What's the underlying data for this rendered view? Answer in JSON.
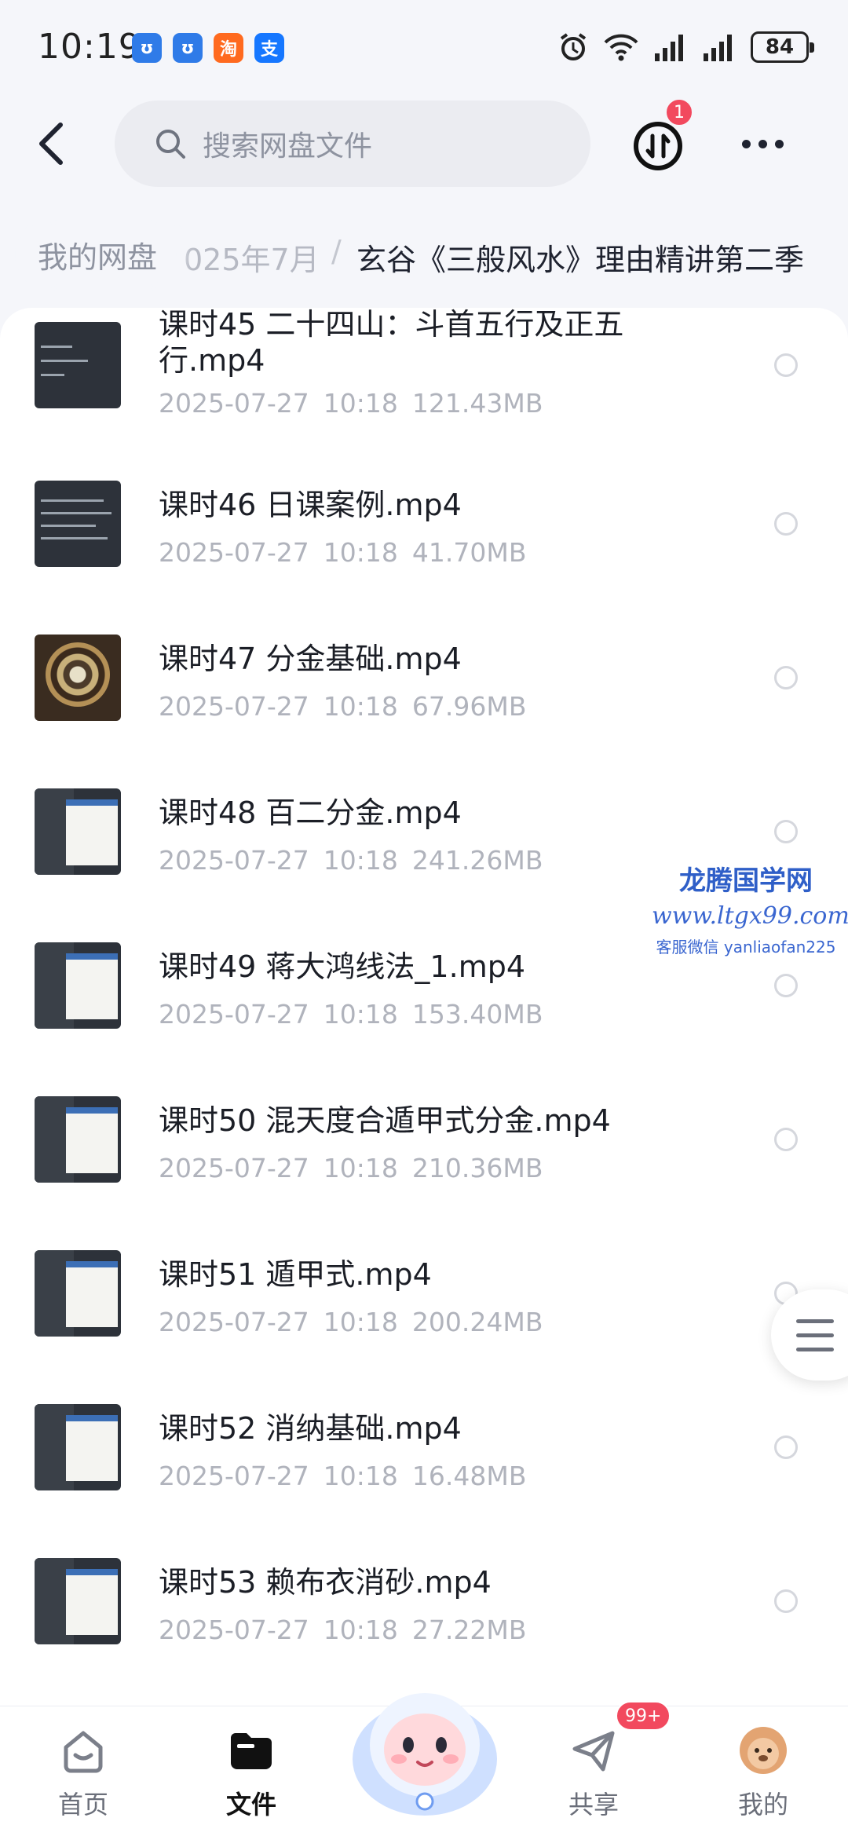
{
  "status_bar": {
    "time": "10:19",
    "notification_icons": [
      {
        "icon": "app-blue-icon",
        "glyph": "ʊ",
        "color": "#2f7be8"
      },
      {
        "icon": "app-blue-icon",
        "glyph": "ʊ",
        "color": "#2f7be8"
      },
      {
        "icon": "taobao-icon",
        "glyph": "淘",
        "color": "#ff6a1f"
      },
      {
        "icon": "alipay-icon",
        "glyph": "支",
        "color": "#1677ff"
      }
    ],
    "battery": "84"
  },
  "header": {
    "search_placeholder": "搜索网盘文件",
    "transfer_badge": "1"
  },
  "breadcrumb": {
    "root": "我的网盘",
    "middle": "025年7月",
    "separator": "/",
    "current": "玄谷《三般风水》理由精讲第二季"
  },
  "files": [
    {
      "name": "课时45 二十四山：斗首五行及正五行.mp4",
      "date": "2025-07-27",
      "time": "10:18",
      "size": "121.43MB",
      "thumb": "terminal"
    },
    {
      "name": "课时46 日课案例.mp4",
      "date": "2025-07-27",
      "time": "10:18",
      "size": "41.70MB",
      "thumb": "terminal"
    },
    {
      "name": "课时47 分金基础.mp4",
      "date": "2025-07-27",
      "time": "10:18",
      "size": "67.96MB",
      "thumb": "compass"
    },
    {
      "name": "课时48 百二分金.mp4",
      "date": "2025-07-27",
      "time": "10:18",
      "size": "241.26MB",
      "thumb": "window"
    },
    {
      "name": "课时49 蒋大鸿线法_1.mp4",
      "date": "2025-07-27",
      "time": "10:18",
      "size": "153.40MB",
      "thumb": "window"
    },
    {
      "name": "课时50 混天度合遁甲式分金.mp4",
      "date": "2025-07-27",
      "time": "10:18",
      "size": "210.36MB",
      "thumb": "window"
    },
    {
      "name": "课时51 遁甲式.mp4",
      "date": "2025-07-27",
      "time": "10:18",
      "size": "200.24MB",
      "thumb": "window"
    },
    {
      "name": "课时52 消纳基础.mp4",
      "date": "2025-07-27",
      "time": "10:18",
      "size": "16.48MB",
      "thumb": "window"
    },
    {
      "name": "课时53 赖布衣消砂.mp4",
      "date": "2025-07-27",
      "time": "10:18",
      "size": "27.22MB",
      "thumb": "window"
    }
  ],
  "watermark": {
    "title": "龙腾国学网",
    "url": "www.ltgx99.com",
    "contact": "客服微信 yanliaofan225"
  },
  "bottom_nav": {
    "items": [
      {
        "label": "首页",
        "icon": "home-icon",
        "active": false
      },
      {
        "label": "文件",
        "icon": "folder-icon",
        "active": true
      },
      {
        "label": "共享",
        "icon": "share-plane-icon",
        "active": false
      },
      {
        "label": "我的",
        "icon": "avatar-icon",
        "active": false
      }
    ],
    "share_badge": "99+"
  },
  "colors": {
    "accent_badge": "#f2495e",
    "watermark_blue": "#2f5fc8"
  }
}
